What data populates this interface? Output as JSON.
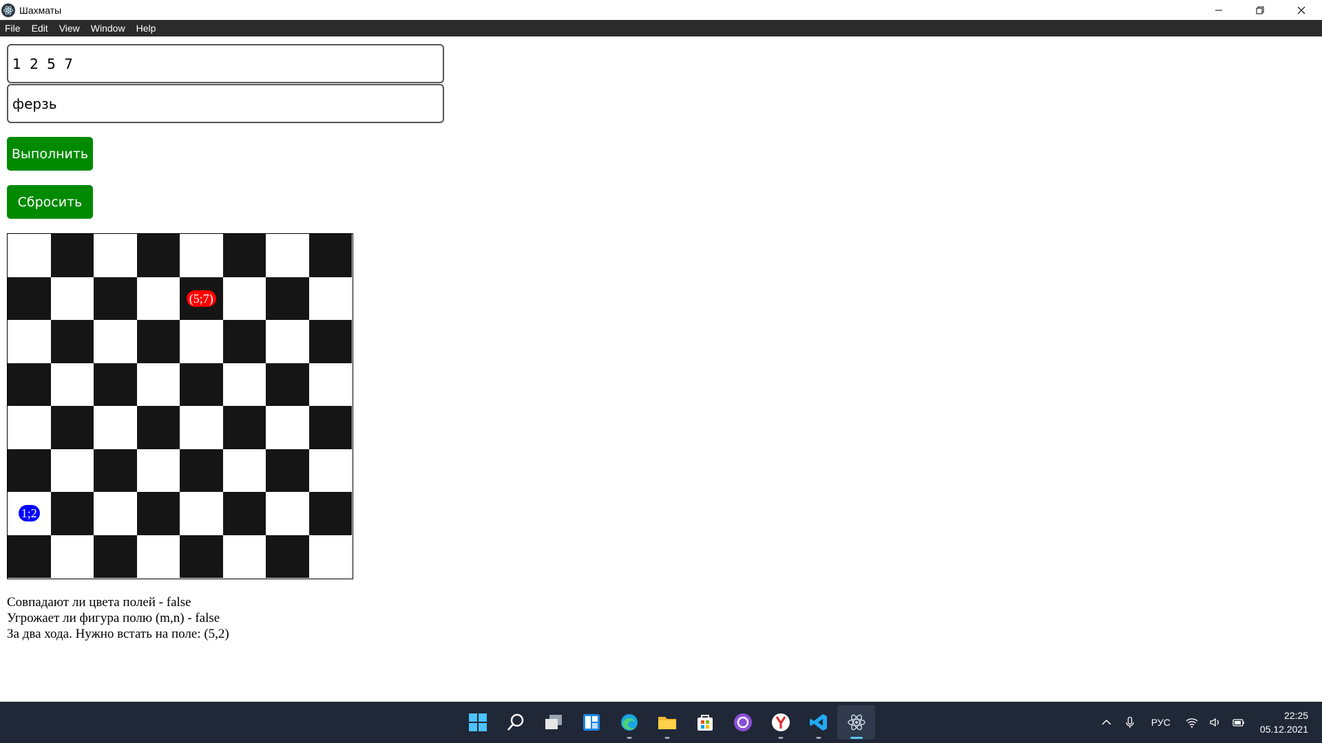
{
  "window": {
    "title": "Шахматы"
  },
  "menu": [
    "File",
    "Edit",
    "View",
    "Window",
    "Help"
  ],
  "inputs": {
    "coords_value": "1 2 5 7",
    "piece_value": "ферзь"
  },
  "buttons": {
    "run_label": "Выполнить",
    "reset_label": "Сбросить"
  },
  "board": {
    "size": 8,
    "top_left": "light",
    "colors": {
      "dark": "#151515",
      "light": "#ffffff"
    },
    "markers": [
      {
        "label": "(5;7)",
        "row": 2,
        "col": 5,
        "color": "#ff0000"
      },
      {
        "label": "1;2",
        "row": 7,
        "col": 1,
        "color": "#0000ff"
      }
    ]
  },
  "results": [
    "Совпадают ли цвета полей - false",
    "Угрожает ли фигура полю (m,n) - false",
    "За два хода. Нужно встать на поле: (5,2)"
  ],
  "taskbar": {
    "apps": [
      "windows-start-icon",
      "search-icon",
      "task-view-icon",
      "widgets-icon",
      "edge-icon",
      "file-explorer-icon",
      "store-icon",
      "github-icon",
      "yandex-icon",
      "vscode-icon",
      "electron-icon"
    ],
    "language": "РУС",
    "time": "22:25",
    "date": "05.12.2021"
  }
}
